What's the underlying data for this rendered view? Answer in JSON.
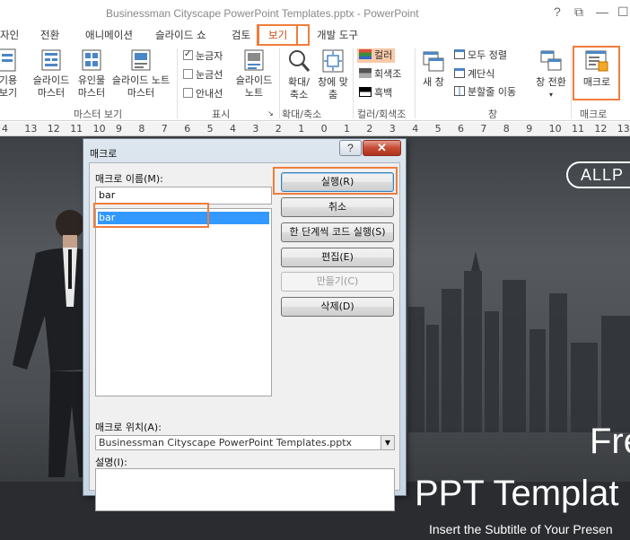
{
  "window": {
    "title": "Businessman Cityscape PowerPoint Templates.pptx - PowerPoint",
    "controls": {
      "help": "?",
      "restore": "⧉",
      "minimize": "—",
      "maximize": "☐"
    }
  },
  "tabs": [
    {
      "label": "자인"
    },
    {
      "label": "전환"
    },
    {
      "label": "애니메이션"
    },
    {
      "label": "슬라이드 쇼"
    },
    {
      "label": "검토"
    },
    {
      "label": "보기",
      "active": true
    },
    {
      "label": "개발 도구"
    }
  ],
  "ribbon": {
    "master_views": {
      "partial": "기용 보기",
      "slide_master": "슬라이드 마스터",
      "handout_master": "유인물 마스터",
      "notes_master": "슬라이드 노트 마스터",
      "group": "마스터 보기"
    },
    "show": {
      "ruler": "눈금자",
      "ruler_checked": true,
      "gridlines": "눈금선",
      "guides": "안내선",
      "notes": "슬라이드 노트",
      "group": "표시"
    },
    "zoom": {
      "zoom": "확대/ 축소",
      "fit": "창에 맞춤",
      "group": "확대/축소"
    },
    "color": {
      "color": "컬러",
      "grayscale": "회색조",
      "bw": "흑백",
      "group": "컬러/회색조"
    },
    "window": {
      "new_window": "새 창",
      "arrange_all": "모두 정렬",
      "cascade": "계단식",
      "move_split": "분할줄 이동",
      "switch": "창 전환",
      "group": "창"
    },
    "macros": {
      "label": "매크로",
      "group": "매크로"
    }
  },
  "ruler": {
    "numbers": [
      "4",
      "13",
      "12",
      "11",
      "10",
      "9",
      "8",
      "7",
      "6",
      "5",
      "4",
      "3",
      "2",
      "1",
      "0",
      "1",
      "2",
      "3",
      "4",
      "5",
      "6",
      "7",
      "8",
      "9",
      "10",
      "11",
      "12",
      "13"
    ]
  },
  "dialog": {
    "title": "매크로",
    "help": "?",
    "close": "✕",
    "name_label": "매크로 이름(M):",
    "name_value": "bar",
    "list": [
      "bar"
    ],
    "buttons": {
      "run": "실행(R)",
      "cancel": "취소",
      "step": "한 단계씩 코드 실행(S)",
      "edit": "편집(E)",
      "create": "만들기(C)",
      "delete": "삭제(D)"
    },
    "location_label": "매크로 위치(A):",
    "location_value": "Businessman Cityscape PowerPoint Templates.pptx",
    "desc_label": "설명(I):"
  },
  "slide": {
    "logo": "ALLP",
    "big_text": "Fre",
    "template_text": "PPT Templat",
    "subtitle": "Insert the Subtitle of Your Presen"
  },
  "colors": {
    "highlight": "#f07d3c",
    "selection": "#3399ff",
    "close_button": "#c74a33"
  }
}
